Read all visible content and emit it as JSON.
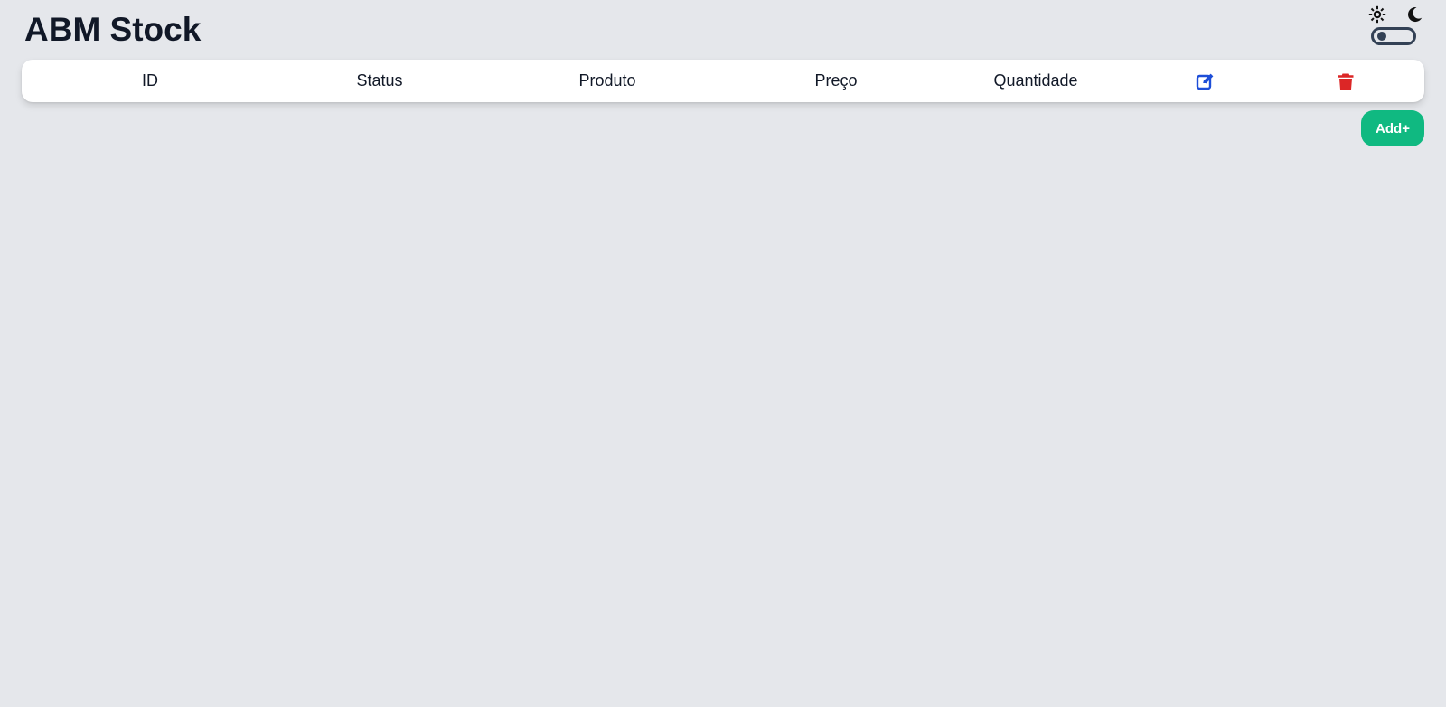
{
  "header": {
    "title": "ABM Stock"
  },
  "theme_toggle": {
    "light_icon": "sun-icon",
    "dark_icon": "moon-icon",
    "state": "light"
  },
  "table": {
    "columns": [
      "ID",
      "Status",
      "Produto",
      "Preço",
      "Quantidade"
    ],
    "action_icons": [
      "edit-icon",
      "delete-icon"
    ],
    "rows": []
  },
  "actions": {
    "add_label": "Add+"
  },
  "colors": {
    "background": "#e5e7eb",
    "title": "#111827",
    "edit": "#1d4ed8",
    "delete": "#dc2626",
    "add_button": "#10b981"
  }
}
